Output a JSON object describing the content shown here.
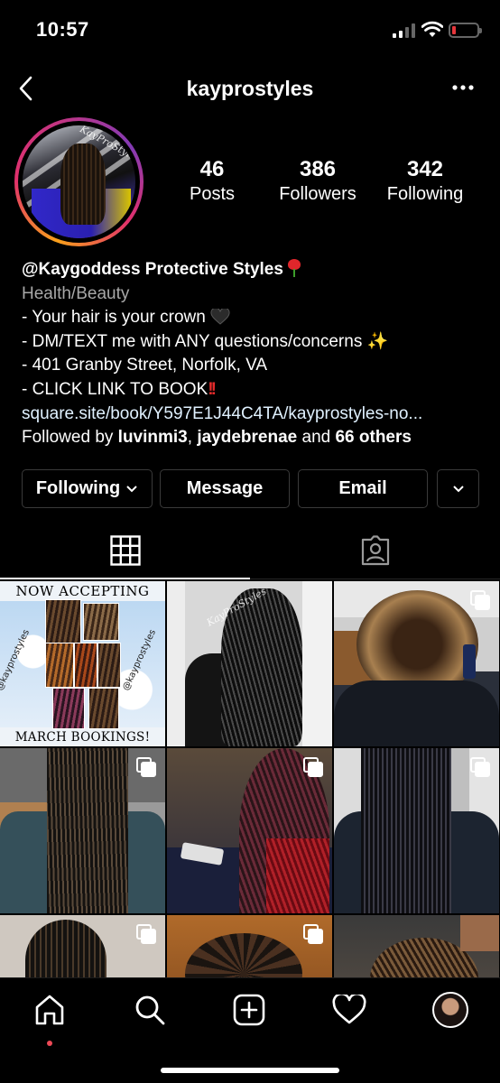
{
  "status_bar": {
    "time": "10:57"
  },
  "header": {
    "username": "kayprostyles"
  },
  "profile": {
    "avatar_brand": "KayProStyles",
    "stats": [
      {
        "value": "46",
        "label": "Posts"
      },
      {
        "value": "386",
        "label": "Followers"
      },
      {
        "value": "342",
        "label": "Following"
      }
    ],
    "display_name": "@Kaygoddess Protective Styles",
    "category": "Health/Beauty",
    "bio_lines": [
      "- Your hair is your crown",
      "- DM/TEXT me with ANY questions/concerns",
      "- 401 Granby Street, Norfolk, VA",
      "- CLICK LINK TO BOOK"
    ],
    "link": "square.site/book/Y597E1J44C4TA/kayprostyles-no...",
    "followed_by": {
      "prefix": "Followed by",
      "user1": "luvinmi3",
      "user2": "jaydebrenae",
      "conj": "and",
      "others": "66 others"
    }
  },
  "actions": {
    "following": "Following",
    "message": "Message",
    "email": "Email"
  },
  "tabs": [
    {
      "icon": "grid-icon",
      "active": true
    },
    {
      "icon": "tagged-icon",
      "active": false
    }
  ],
  "posts": {
    "poster": {
      "top": "NOW ACCEPTING",
      "bottom": "MARCH BOOKINGS!",
      "handle": "@kayprostyles"
    },
    "watermark": "KayProStyles"
  },
  "colors": {
    "background": "#000000",
    "link": "#e0f1ff",
    "secondary": "#a8a8a8",
    "notification": "#ed4956"
  },
  "tab_bar": [
    "home-icon",
    "search-icon",
    "new-post-icon",
    "activity-icon",
    "profile-avatar"
  ]
}
